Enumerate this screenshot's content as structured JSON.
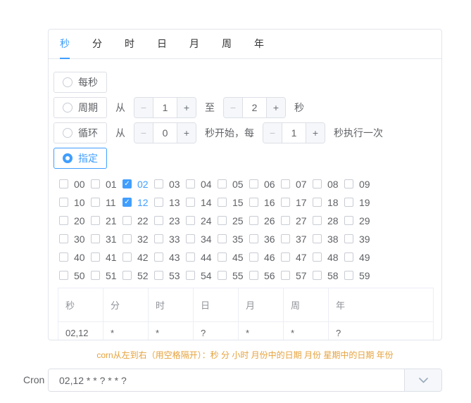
{
  "colors": {
    "accent": "#409eff",
    "warning": "#e6a23c",
    "border": "#dcdfe6",
    "text": "#606266",
    "muted": "#909399"
  },
  "icons": {
    "minus": "−",
    "plus": "+",
    "check": "✓",
    "chevron_down": "chevron-down"
  },
  "tabs": {
    "items": [
      {
        "label": "秒",
        "active": true
      },
      {
        "label": "分",
        "active": false
      },
      {
        "label": "时",
        "active": false
      },
      {
        "label": "日",
        "active": false
      },
      {
        "label": "月",
        "active": false
      },
      {
        "label": "周",
        "active": false
      },
      {
        "label": "年",
        "active": false
      }
    ]
  },
  "modes": {
    "every": {
      "label": "每秒",
      "selected": false
    },
    "range": {
      "label": "周期",
      "selected": false,
      "from_text": "从",
      "from_value": "1",
      "to_text": "至",
      "to_value": "2",
      "unit_text": "秒"
    },
    "loop": {
      "label": "循环",
      "selected": false,
      "from_text": "从",
      "start_value": "0",
      "mid_text": "秒开始，每",
      "step_value": "1",
      "end_text": "秒执行一次"
    },
    "specify": {
      "label": "指定",
      "selected": true
    }
  },
  "seconds_grid": {
    "options": [
      "00",
      "01",
      "02",
      "03",
      "04",
      "05",
      "06",
      "07",
      "08",
      "09",
      "10",
      "11",
      "12",
      "13",
      "14",
      "15",
      "16",
      "17",
      "18",
      "19",
      "20",
      "21",
      "22",
      "23",
      "24",
      "25",
      "26",
      "27",
      "28",
      "29",
      "30",
      "31",
      "32",
      "33",
      "34",
      "35",
      "36",
      "37",
      "38",
      "39",
      "40",
      "41",
      "42",
      "43",
      "44",
      "45",
      "46",
      "47",
      "48",
      "49",
      "50",
      "51",
      "52",
      "53",
      "54",
      "55",
      "56",
      "57",
      "58",
      "59"
    ],
    "checked": [
      "02",
      "12"
    ],
    "columns_per_row": 10
  },
  "result_table": {
    "headers": [
      "秒",
      "分",
      "时",
      "日",
      "月",
      "周",
      "年"
    ],
    "row": [
      "02,12",
      "*",
      "*",
      "?",
      "*",
      "*",
      "?"
    ]
  },
  "tip_text": "corn从左到右（用空格隔开）：秒 分 小时 月份中的日期 月份 星期中的日期 年份",
  "cron_field": {
    "label": "Cron",
    "value": "02,12 * * ? * * ?"
  }
}
